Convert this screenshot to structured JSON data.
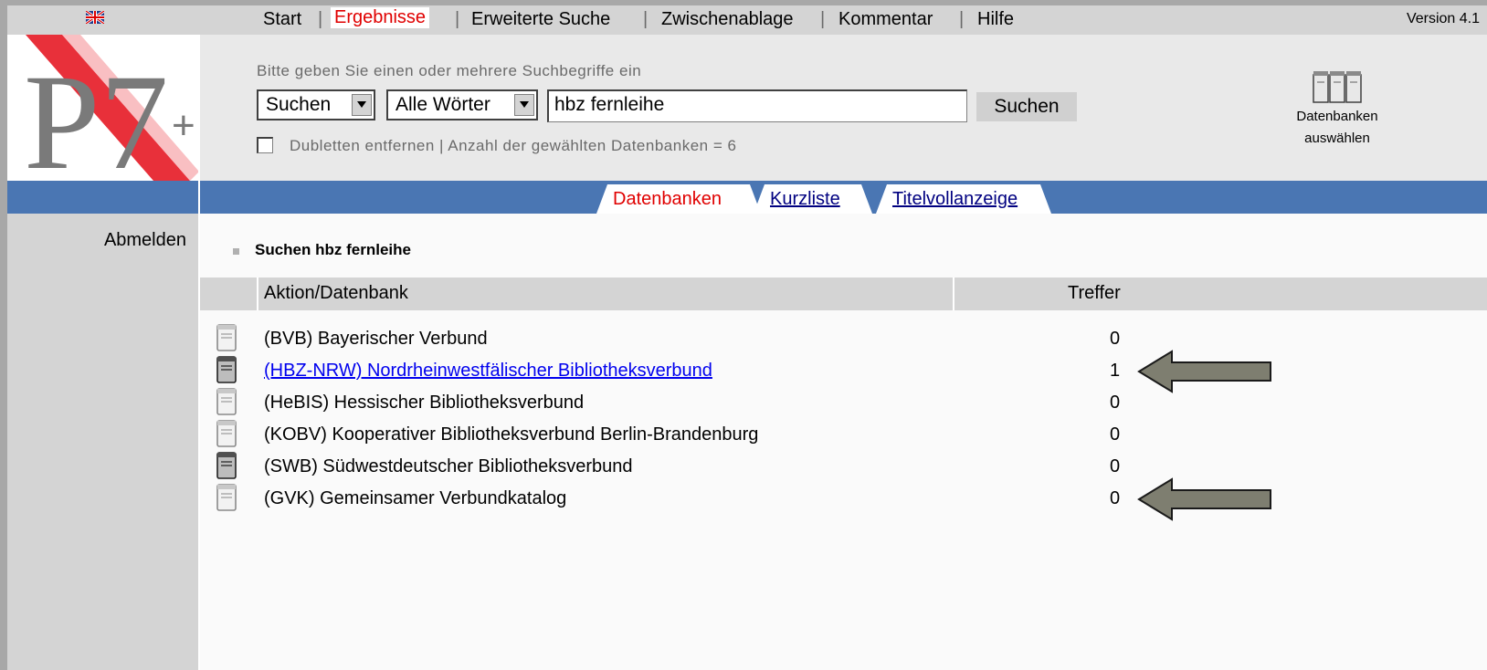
{
  "topbar": {
    "nav": [
      "Start",
      "Ergebnisse",
      "Erweiterte Suche",
      "Zwischenablage",
      "Kommentar",
      "Hilfe"
    ],
    "active": "Ergebnisse",
    "version": "Version 4.1"
  },
  "logo": {
    "text": "P7",
    "plus": "+"
  },
  "sidebar": {
    "logout": "Abmelden"
  },
  "search": {
    "hint": "Bitte geben Sie einen oder mehrere Suchbegriffe ein",
    "mode": "Suchen",
    "match": "Alle Wörter",
    "query": "hbz fernleihe",
    "button": "Suchen",
    "dedup_label": "Dubletten entfernen | Anzahl der gewählten Datenbanken = 6",
    "dedup_checked": false
  },
  "db_select": {
    "line1": "Datenbanken",
    "line2": "auswählen"
  },
  "tabs": [
    {
      "label": "Datenbanken",
      "state": "active"
    },
    {
      "label": "Kurzliste",
      "state": "link"
    },
    {
      "label": "Titelvollanzeige",
      "state": "link"
    }
  ],
  "results": {
    "title": "Suchen  hbz fernleihe",
    "col_action": "Aktion/Datenbank",
    "col_hits": "Treffer",
    "rows": [
      {
        "name": "(BVB) Bayerischer Verbund",
        "hits": "0",
        "link": false,
        "icon": "server-icon-light"
      },
      {
        "name": "(HBZ-NRW) Nordrheinwestfälischer Bibliotheksverbund",
        "hits": "1",
        "link": true,
        "icon": "server-icon-dark",
        "arrow": true
      },
      {
        "name": "(HeBIS) Hessischer Bibliotheksverbund",
        "hits": "0",
        "link": false,
        "icon": "server-icon-light"
      },
      {
        "name": "(KOBV) Kooperativer Bibliotheksverbund Berlin-Brandenburg",
        "hits": "0",
        "link": false,
        "icon": "server-icon-light"
      },
      {
        "name": "(SWB) Südwestdeutscher Bibliotheksverbund",
        "hits": "0",
        "link": false,
        "icon": "server-icon-dark"
      },
      {
        "name": "(GVK) Gemeinsamer Verbundkatalog",
        "hits": "0",
        "link": false,
        "icon": "server-icon-light",
        "arrow": true
      }
    ]
  },
  "colors": {
    "accent_blue": "#4a76b3",
    "active_red": "#e00000",
    "link_blue": "#0000ee"
  }
}
